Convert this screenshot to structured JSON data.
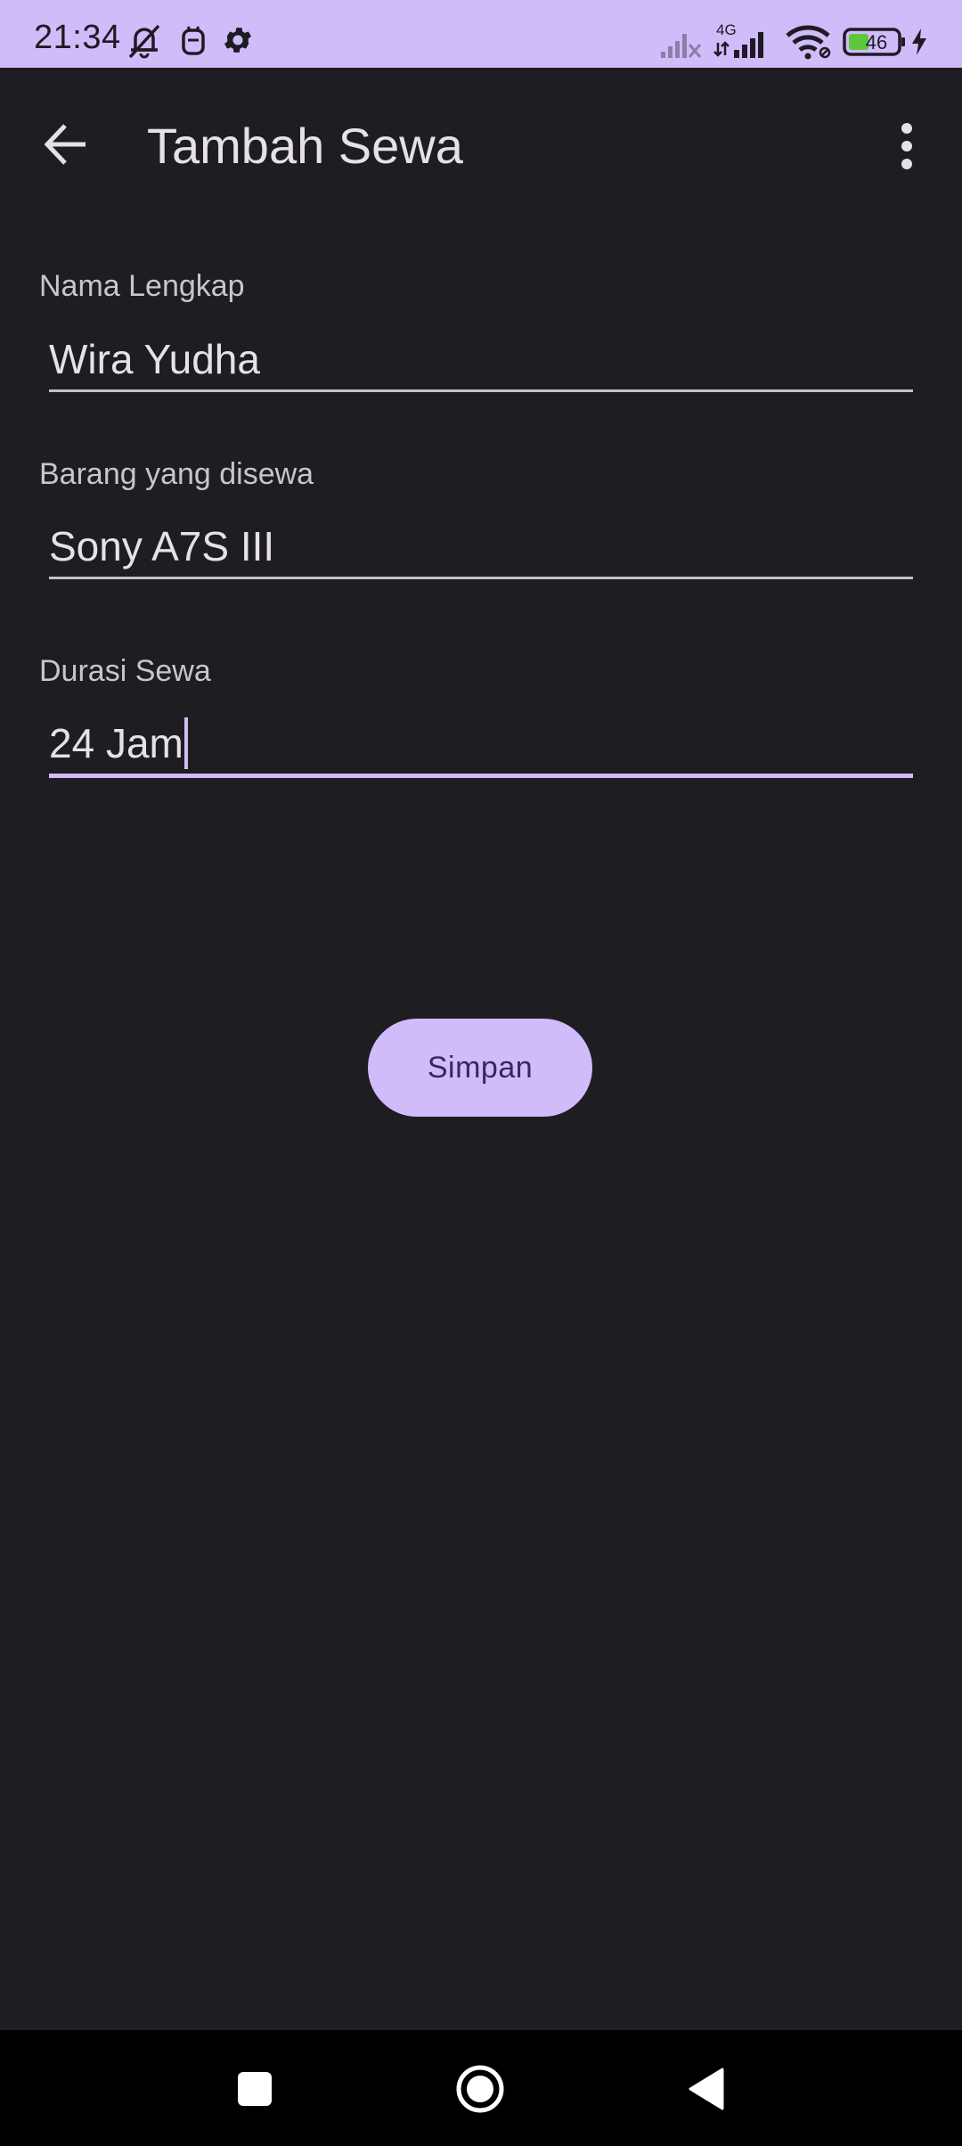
{
  "status_bar": {
    "time": "21:34",
    "network_type": "4G",
    "battery_level": "46",
    "icons": [
      "muted-bell-icon",
      "screen-cat-icon",
      "settings-gear-icon",
      "signal-none-icon",
      "signal-4g-icon",
      "wifi-icon",
      "battery-icon",
      "charging-icon"
    ]
  },
  "app_bar": {
    "title": "Tambah Sewa",
    "back_icon": "arrow-back-icon",
    "more_icon": "more-vert-icon"
  },
  "form": {
    "fields": [
      {
        "label": "Nama Lengkap",
        "value": "Wira Yudha"
      },
      {
        "label": "Barang yang disewa",
        "value": "Sony A7S III"
      },
      {
        "label": "Durasi Sewa",
        "value": "24 Jam"
      }
    ],
    "save_label": "Simpan"
  },
  "colors": {
    "accent": "#d1bcfa",
    "background": "#1e1d22",
    "on_accent": "#382466"
  },
  "nav_bar": {
    "icons": [
      "recents-square-icon",
      "home-circle-icon",
      "back-triangle-icon"
    ]
  }
}
